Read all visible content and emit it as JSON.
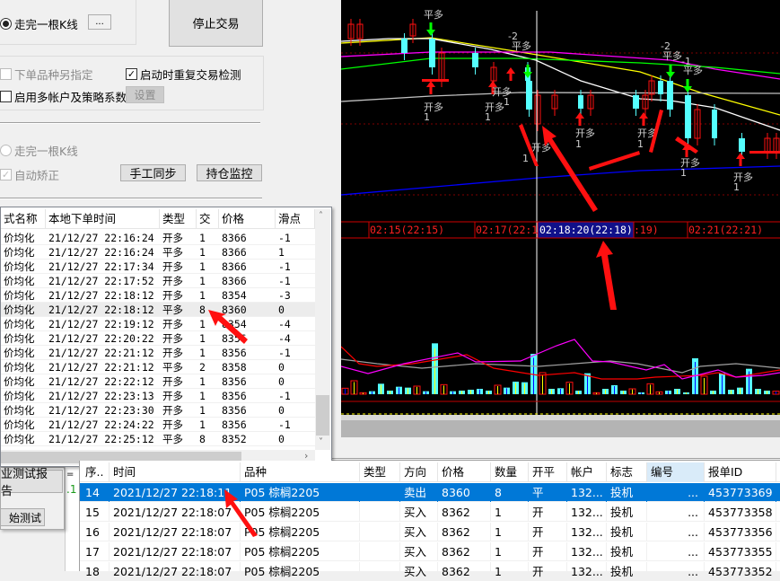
{
  "dialog": {
    "radio_kline": "走完一根K线",
    "more_button": "...",
    "stop_button": "停止交易",
    "chk_symbol": "下单品种另指定",
    "chk_repeat": "启动时重复交易检测",
    "chk_multi": "启用多帐户及策略系数",
    "settings_button": "设置",
    "radio_kline2": "走完一根K线",
    "chk_autofix": "自动矫正",
    "sync_button": "手工同步",
    "monitor_button": "持仓监控"
  },
  "orders": {
    "columns": [
      "式名称",
      "本地下单时间",
      "类型",
      "交",
      "价格",
      "滑点"
    ],
    "rows": [
      [
        "价均化",
        "21/12/27 22:16:24",
        "开多",
        "1",
        "8366",
        "-1"
      ],
      [
        "价均化",
        "21/12/27 22:16:24",
        "平多",
        "1",
        "8366",
        "1"
      ],
      [
        "价均化",
        "21/12/27 22:17:34",
        "开多",
        "1",
        "8366",
        "-1"
      ],
      [
        "价均化",
        "21/12/27 22:17:52",
        "开多",
        "1",
        "8366",
        "-1"
      ],
      [
        "价均化",
        "21/12/27 22:18:12",
        "开多",
        "1",
        "8354",
        "-3"
      ],
      [
        "价均化",
        "21/12/27 22:18:12",
        "平多",
        "8",
        "8360",
        "0"
      ],
      [
        "价均化",
        "21/12/27 22:19:12",
        "开多",
        "1",
        "8354",
        "-4"
      ],
      [
        "价均化",
        "21/12/27 22:20:22",
        "开多",
        "1",
        "8356",
        "-4"
      ],
      [
        "价均化",
        "21/12/27 22:21:12",
        "开多",
        "1",
        "8356",
        "-1"
      ],
      [
        "价均化",
        "21/12/27 22:21:12",
        "平多",
        "2",
        "8358",
        "0"
      ],
      [
        "价均化",
        "21/12/27 22:22:12",
        "开多",
        "1",
        "8356",
        "0"
      ],
      [
        "价均化",
        "21/12/27 22:23:13",
        "开多",
        "1",
        "8356",
        "-1"
      ],
      [
        "价均化",
        "21/12/27 22:23:30",
        "开多",
        "1",
        "8356",
        "0"
      ],
      [
        "价均化",
        "21/12/27 22:24:22",
        "开多",
        "1",
        "8356",
        "-1"
      ],
      [
        "价均化",
        "21/12/27 22:25:12",
        "平多",
        "8",
        "8352",
        "0"
      ]
    ]
  },
  "chart": {
    "time_labels": [
      "02:15(22:15)",
      "02:17(22:1",
      "02:18:20(22:18)",
      ":19)",
      "02:21(22:21)"
    ],
    "signals": [
      "平多",
      "开多",
      "1",
      "开多",
      "1",
      "-2",
      "平多",
      "开多",
      "1",
      "开多",
      "1",
      "开多",
      "1",
      "开多",
      "1",
      "-2",
      "平多",
      "-1",
      "平多",
      "开多",
      "1",
      "开多",
      "1"
    ]
  },
  "side": {
    "report_button": "业测试报告",
    "start_button": "始测试",
    "value": ".1"
  },
  "trades": {
    "columns": [
      "序..",
      "时间",
      "品种",
      "类型",
      "方向",
      "价格",
      "数量",
      "开平",
      "帐户",
      "标志",
      "编号",
      "报单ID"
    ],
    "rows": [
      [
        "14",
        "2021/12/27 22:18:11",
        "P05 棕榈2205",
        "",
        "卖出",
        "8360",
        "8",
        "平",
        "132...",
        "投机",
        "...",
        "453773369"
      ],
      [
        "15",
        "2021/12/27 22:18:07",
        "P05 棕榈2205",
        "",
        "买入",
        "8362",
        "1",
        "开",
        "132...",
        "投机",
        "...",
        "453773358"
      ],
      [
        "16",
        "2021/12/27 22:18:07",
        "P05 棕榈2205",
        "",
        "买入",
        "8362",
        "1",
        "开",
        "132...",
        "投机",
        "...",
        "453773356"
      ],
      [
        "17",
        "2021/12/27 22:18:07",
        "P05 棕榈2205",
        "",
        "买入",
        "8362",
        "1",
        "开",
        "132...",
        "投机",
        "...",
        "453773355"
      ],
      [
        "18",
        "2021/12/27 22:18:07",
        "P05 棕榈2205",
        "",
        "买入",
        "8362",
        "1",
        "开",
        "132...",
        "投机",
        "...",
        "453773352"
      ]
    ]
  },
  "colors": {
    "accent": "#0078d7",
    "annotation": "#ff1010",
    "chart_bg": "#000000"
  }
}
